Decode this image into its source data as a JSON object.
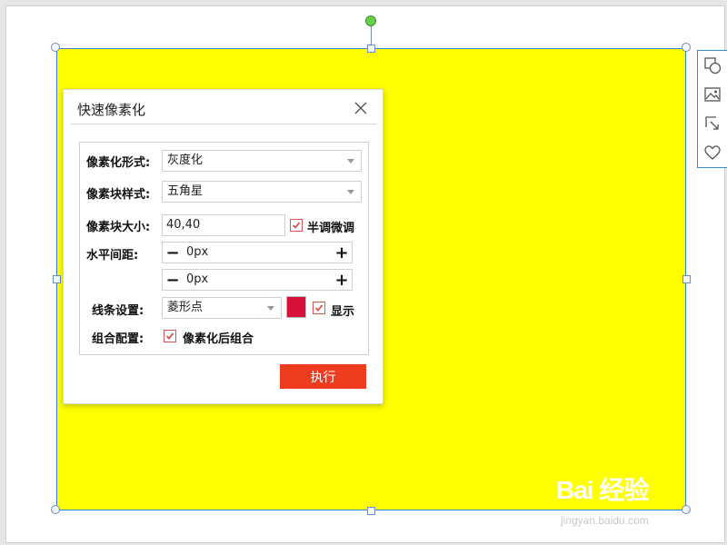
{
  "colors": {
    "shape_fill": "#ffff00",
    "selection_border": "#3a7bd5",
    "execute_button": "#f03c1e",
    "line_color": "#d8113a",
    "rotate_handle": "#6ad04a",
    "checkbox_accent": "#d9534f"
  },
  "side_toolbar": {
    "icons": [
      "shapes-icon",
      "image-icon",
      "crop-resize-icon",
      "heart-icon"
    ]
  },
  "dialog": {
    "title": "快速像素化",
    "close_icon": "close-icon",
    "fields": {
      "pixel_mode": {
        "label": "像素化形式:",
        "value": "灰度化"
      },
      "block_style": {
        "label": "像素块样式:",
        "value": "五角星"
      },
      "block_size": {
        "label": "像素块大小:",
        "value": "40,40",
        "fine_tune_label": "半调微调",
        "fine_tune_checked": true
      },
      "spacing": {
        "label": "水平间距:",
        "horizontal_value": "0px",
        "vertical_value": "0px"
      },
      "line": {
        "label": "线条设置:",
        "value": "菱形点",
        "show_label": "显示",
        "show_checked": true
      },
      "group": {
        "label": "组合配置:",
        "option_label": "像素化后组合",
        "option_checked": true
      }
    },
    "execute_label": "执行"
  },
  "watermark": {
    "logo": "Bai 经验",
    "url": "jingyan.baidu.com"
  }
}
